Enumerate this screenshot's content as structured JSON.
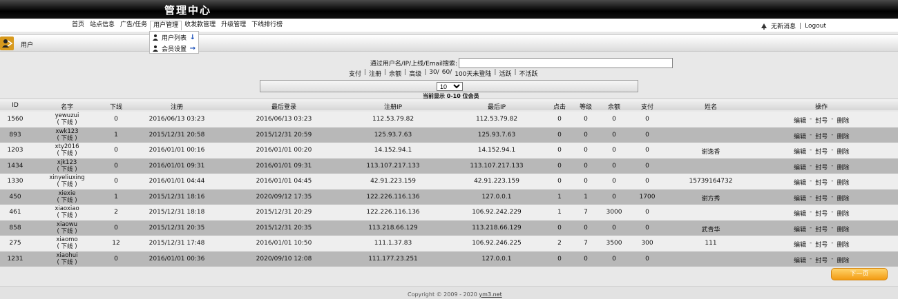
{
  "header": {
    "brand": "管理中心"
  },
  "nav": {
    "items": [
      "首页",
      "站点信息",
      "广告/任务",
      "用户管理",
      "收发款管理",
      "升级管理",
      "下线排行榜"
    ],
    "active_index": 3,
    "right": {
      "messages": "无新消息",
      "sep": "|",
      "logout": "Logout"
    }
  },
  "dropdown": {
    "items": [
      {
        "label": "用户列表",
        "arrow": "↓"
      },
      {
        "label": "会员设置",
        "arrow": "→"
      }
    ]
  },
  "page_title": "用户",
  "search": {
    "label": "通过用户名/IP/上线/Email搜索:",
    "value": "",
    "filters": [
      "支付",
      "|",
      "注册",
      "|",
      "余额",
      "|",
      "高级",
      "|",
      "30/",
      "60/",
      "100天未登陆",
      "|",
      "活跃",
      "|",
      "不活跃"
    ]
  },
  "pager": {
    "per_page": "10",
    "count_label": "当前显示 0-10 位会员",
    "next_label": "下一页"
  },
  "table": {
    "headers": [
      "ID",
      "名字",
      "下线",
      "注册",
      "最后登录",
      "注册IP",
      "最后IP",
      "点击",
      "等级",
      "余额",
      "支付",
      "姓名",
      "操作"
    ],
    "downline_tag": "( 下线 )",
    "ops": [
      "编辑",
      "-",
      "封号",
      "-",
      "删除"
    ],
    "rows": [
      {
        "id": "1560",
        "name": "yewuzui",
        "down": "0",
        "reg": "2016/06/13 03:23",
        "last": "2016/06/13 03:23",
        "regip": "112.53.79.82",
        "lastip": "112.53.79.82",
        "clicks": "0",
        "level": "0",
        "balance": "0",
        "paid": "0",
        "realname": ""
      },
      {
        "id": "893",
        "name": "xwk123",
        "down": "1",
        "reg": "2015/12/31 20:58",
        "last": "2015/12/31 20:59",
        "regip": "125.93.7.63",
        "lastip": "125.93.7.63",
        "clicks": "0",
        "level": "0",
        "balance": "0",
        "paid": "0",
        "realname": ""
      },
      {
        "id": "1203",
        "name": "xty2016",
        "down": "0",
        "reg": "2016/01/01 00:16",
        "last": "2016/01/01 00:20",
        "regip": "14.152.94.1",
        "lastip": "14.152.94.1",
        "clicks": "0",
        "level": "0",
        "balance": "0",
        "paid": "0",
        "realname": "谢逸香"
      },
      {
        "id": "1434",
        "name": "xjk123",
        "down": "0",
        "reg": "2016/01/01 09:31",
        "last": "2016/01/01 09:31",
        "regip": "113.107.217.133",
        "lastip": "113.107.217.133",
        "clicks": "0",
        "level": "0",
        "balance": "0",
        "paid": "0",
        "realname": ""
      },
      {
        "id": "1330",
        "name": "xinyeliuxing",
        "down": "0",
        "reg": "2016/01/01 04:44",
        "last": "2016/01/01 04:45",
        "regip": "42.91.223.159",
        "lastip": "42.91.223.159",
        "clicks": "0",
        "level": "0",
        "balance": "0",
        "paid": "0",
        "realname": "15739164732"
      },
      {
        "id": "450",
        "name": "xiexie",
        "down": "1",
        "reg": "2015/12/31 18:16",
        "last": "2020/09/12 17:35",
        "regip": "122.226.116.136",
        "lastip": "127.0.0.1",
        "clicks": "1",
        "level": "1",
        "balance": "0",
        "paid": "1700",
        "realname": "谢方秀"
      },
      {
        "id": "461",
        "name": "xiaoxiao",
        "down": "2",
        "reg": "2015/12/31 18:18",
        "last": "2015/12/31 20:29",
        "regip": "122.226.116.136",
        "lastip": "106.92.242.229",
        "clicks": "1",
        "level": "7",
        "balance": "3000",
        "paid": "0",
        "realname": ""
      },
      {
        "id": "858",
        "name": "xiaowu",
        "down": "0",
        "reg": "2015/12/31 20:35",
        "last": "2015/12/31 20:35",
        "regip": "113.218.66.129",
        "lastip": "113.218.66.129",
        "clicks": "0",
        "level": "0",
        "balance": "0",
        "paid": "0",
        "realname": "武青华"
      },
      {
        "id": "275",
        "name": "xiaomo",
        "down": "12",
        "reg": "2015/12/31 17:48",
        "last": "2016/01/01 10:50",
        "regip": "111.1.37.83",
        "lastip": "106.92.246.225",
        "clicks": "2",
        "level": "7",
        "balance": "3500",
        "paid": "300",
        "realname": "111"
      },
      {
        "id": "1231",
        "name": "xiaohui",
        "down": "0",
        "reg": "2016/01/01 00:36",
        "last": "2020/09/10 12:08",
        "regip": "111.177.23.251",
        "lastip": "127.0.0.1",
        "clicks": "0",
        "level": "0",
        "balance": "0",
        "paid": "0",
        "realname": ""
      }
    ]
  },
  "footer": {
    "copyright": "Copyright © 2009 - 2020",
    "site": "ym3.net"
  },
  "colors": {
    "accent": "#f29b12",
    "header_bg": "#000000",
    "row_alt": "#b8b8b8"
  }
}
